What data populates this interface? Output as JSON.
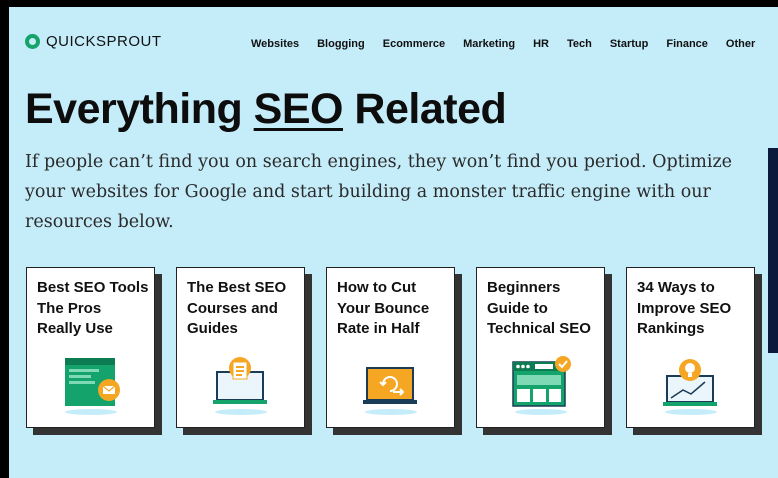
{
  "brand": {
    "name": "QUICKSPROUT"
  },
  "nav": [
    "Websites",
    "Blogging",
    "Ecommerce",
    "Marketing",
    "HR",
    "Tech",
    "Startup",
    "Finance",
    "Other"
  ],
  "hero": {
    "title_before": "Everything ",
    "title_highlight": "SEO",
    "title_after": " Related",
    "description": "If people can’t find you on search engines, they won’t find you period. Optimize your websites for Google and start building a monster traffic engine with our resources below."
  },
  "cards": [
    {
      "title": "Best SEO Tools The Pros Really Use",
      "icon": "email-screen-icon"
    },
    {
      "title": "The Best SEO Courses and Guides",
      "icon": "laptop-checklist-icon"
    },
    {
      "title": "How to Cut Your Bounce Rate in Half",
      "icon": "laptop-refresh-icon"
    },
    {
      "title": "Beginners Guide to Technical SEO",
      "icon": "www-browser-icon"
    },
    {
      "title": "34 Ways to Improve SEO Rankings",
      "icon": "laptop-lightbulb-icon"
    }
  ],
  "colors": {
    "background": "#c5ecf9",
    "accent_green": "#13a36b",
    "accent_orange": "#f5a623",
    "dark_navy": "#0a1a3c"
  }
}
